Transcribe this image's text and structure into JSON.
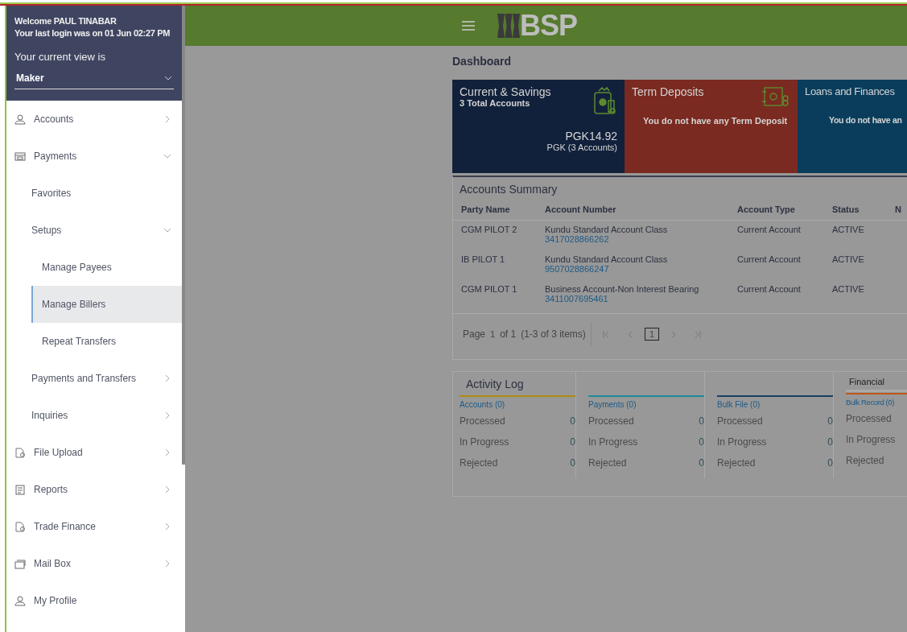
{
  "sidebar": {
    "welcome": "Welcome PAUL TINABAR",
    "last_login": "Your last login was on 01 Jun 02:27 PM",
    "view_label": "Your current view is",
    "view_value": "Maker",
    "items": [
      {
        "label": "Accounts",
        "expanded": false
      },
      {
        "label": "Payments",
        "expanded": true,
        "children": [
          {
            "label": "Favorites",
            "selected": false
          },
          {
            "label": "Setups",
            "expanded": true,
            "children": [
              {
                "label": "Manage Payees",
                "selected": false
              },
              {
                "label": "Manage Billers",
                "selected": true
              },
              {
                "label": "Repeat Transfers",
                "selected": false
              }
            ]
          },
          {
            "label": "Payments and Transfers",
            "expanded": false
          },
          {
            "label": "Inquiries",
            "expanded": false
          }
        ]
      },
      {
        "label": "File Upload",
        "expanded": false
      },
      {
        "label": "Reports",
        "expanded": false
      },
      {
        "label": "Trade Finance",
        "expanded": false
      },
      {
        "label": "Mail Box",
        "expanded": false
      },
      {
        "label": "My Profile"
      }
    ]
  },
  "header": {
    "logo_text": "BSP"
  },
  "page_title": "Dashboard",
  "cards": [
    {
      "kind": "summary",
      "title": "Current & Savings",
      "subtitle": "3 Total Accounts",
      "amount": "PGK14.92",
      "amount_note": "PGK (3 Accounts)",
      "color": "#12213b"
    },
    {
      "kind": "empty",
      "title": "Term Deposits",
      "message": "You do not have any Term Deposit",
      "color": "#7a2a20"
    },
    {
      "kind": "empty",
      "title": "Loans and Finances",
      "message": "You do not have an",
      "color": "#0a3d5c"
    }
  ],
  "accounts_summary": {
    "title": "Accounts Summary",
    "columns": [
      "Party Name",
      "Account Number",
      "Account Type",
      "Status",
      "N"
    ],
    "rows": [
      {
        "party": "CGM PILOT 2",
        "account_class": "Kundu Standard Account Class",
        "account_number": "3417028866262",
        "type": "Current Account",
        "status": "ACTIVE"
      },
      {
        "party": "IB PILOT 1",
        "account_class": "Kundu Standard Account Class",
        "account_number": "9507028866247",
        "type": "Current Account",
        "status": "ACTIVE"
      },
      {
        "party": "CGM PILOT 1",
        "account_class": "Business Account-Non Interest Bearing",
        "account_number": "3411007695461",
        "type": "Current Account",
        "status": "ACTIVE"
      }
    ],
    "pager": {
      "page_label": "Page",
      "page": "1",
      "of": "of 1",
      "items": "(1-3 of 3 items)",
      "pages": [
        {
          "label": "1",
          "selected": true
        }
      ]
    }
  },
  "activity_log": {
    "title": "Activity Log",
    "tab": "Financial",
    "groups": [
      {
        "title": "Accounts (0)",
        "color": "#b08a10",
        "rows": [
          {
            "label": "Processed",
            "value": "0"
          },
          {
            "label": "In Progress",
            "value": "0"
          },
          {
            "label": "Rejected",
            "value": "0"
          }
        ]
      },
      {
        "title": "Payments (0)",
        "color": "#1f8a9a",
        "rows": [
          {
            "label": "Processed",
            "value": "0"
          },
          {
            "label": "In Progress",
            "value": "0"
          },
          {
            "label": "Rejected",
            "value": "0"
          }
        ]
      },
      {
        "title": "Bulk File (0)",
        "color": "#1a3f5e",
        "rows": [
          {
            "label": "Processed",
            "value": "0"
          },
          {
            "label": "In Progress",
            "value": "0"
          },
          {
            "label": "Rejected",
            "value": "0"
          }
        ]
      },
      {
        "title": "Bulk Record (0)",
        "color": "#c0571a",
        "rows": [
          {
            "label": "Processed"
          },
          {
            "label": "In Progress"
          },
          {
            "label": "Rejected"
          }
        ]
      }
    ]
  }
}
